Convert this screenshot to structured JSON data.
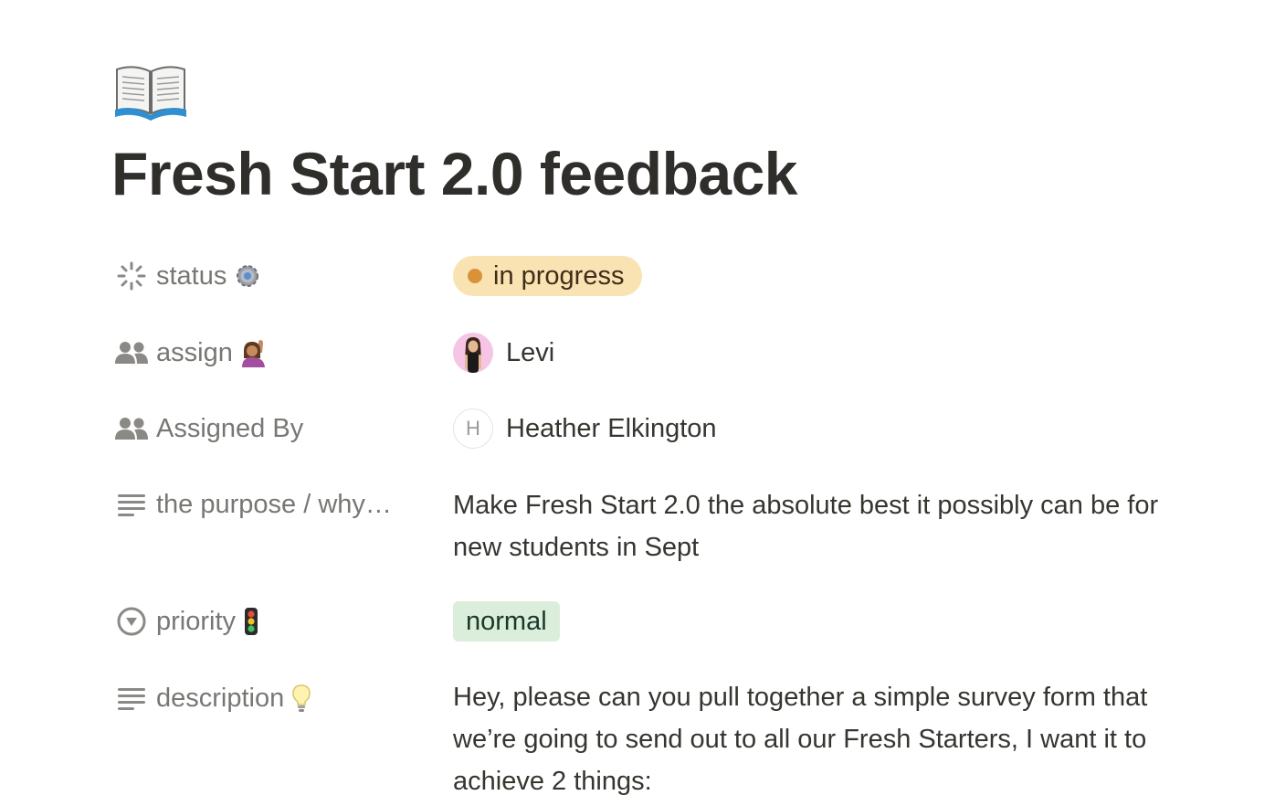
{
  "page": {
    "icon": "open-book-emoji",
    "title": "Fresh Start 2.0 feedback"
  },
  "properties": {
    "status": {
      "label": "status",
      "label_icon": "status-spinner-icon",
      "label_emoji": "⚙️",
      "value": "in progress",
      "value_color": "#fae3b2",
      "dot_color": "#d9923a"
    },
    "assign": {
      "label": "assign",
      "label_icon": "people-icon",
      "label_emoji": "🙋🏽‍♀️",
      "person_name": "Levi"
    },
    "assigned_by": {
      "label": "Assigned By",
      "label_icon": "people-icon",
      "person_initial": "H",
      "person_name": "Heather Elkington"
    },
    "purpose": {
      "label": "the purpose / why…",
      "label_icon": "text-lines-icon",
      "value": "Make Fresh Start 2.0 the absolute best it possibly can be for new students in Sept"
    },
    "priority": {
      "label": "priority",
      "label_icon": "select-circle-icon",
      "label_emoji": "🚦",
      "value": "normal",
      "value_color": "#dbeddb"
    },
    "description": {
      "label": "description",
      "label_icon": "text-lines-icon",
      "label_emoji": "💡",
      "value": "Hey, please can you pull together a simple survey form that we’re going to send out to all our Fresh Starters, I want it to achieve 2 things:"
    }
  }
}
